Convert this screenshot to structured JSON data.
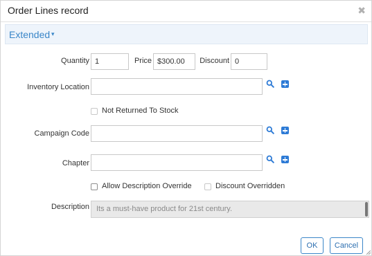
{
  "dialog": {
    "title": "Order Lines record",
    "close_icon": "close-x-icon"
  },
  "section": {
    "label": "Extended",
    "caret": "▾"
  },
  "fields": {
    "quantity": {
      "label": "Quantity",
      "value": "1"
    },
    "price": {
      "label": "Price",
      "value": "$300.00"
    },
    "discount": {
      "label": "Discount",
      "value": "0"
    },
    "inventory_location": {
      "label": "Inventory Location",
      "value": ""
    },
    "not_returned_to_stock": {
      "label": "Not Returned To Stock",
      "checked": false
    },
    "campaign_code": {
      "label": "Campaign Code",
      "value": ""
    },
    "chapter": {
      "label": "Chapter",
      "value": ""
    },
    "allow_description_override": {
      "label": "Allow Description Override",
      "checked": false
    },
    "discount_overridden": {
      "label": "Discount Overridden",
      "checked": false
    },
    "description": {
      "label": "Description",
      "placeholder": "Its a must-have product for 21st century."
    }
  },
  "buttons": {
    "ok": "OK",
    "cancel": "Cancel"
  },
  "colors": {
    "accent": "#3a86c8",
    "icon_blue": "#2e7bd6",
    "section_bg": "#eef4fb",
    "disabled_bg": "#e9e9e9"
  }
}
